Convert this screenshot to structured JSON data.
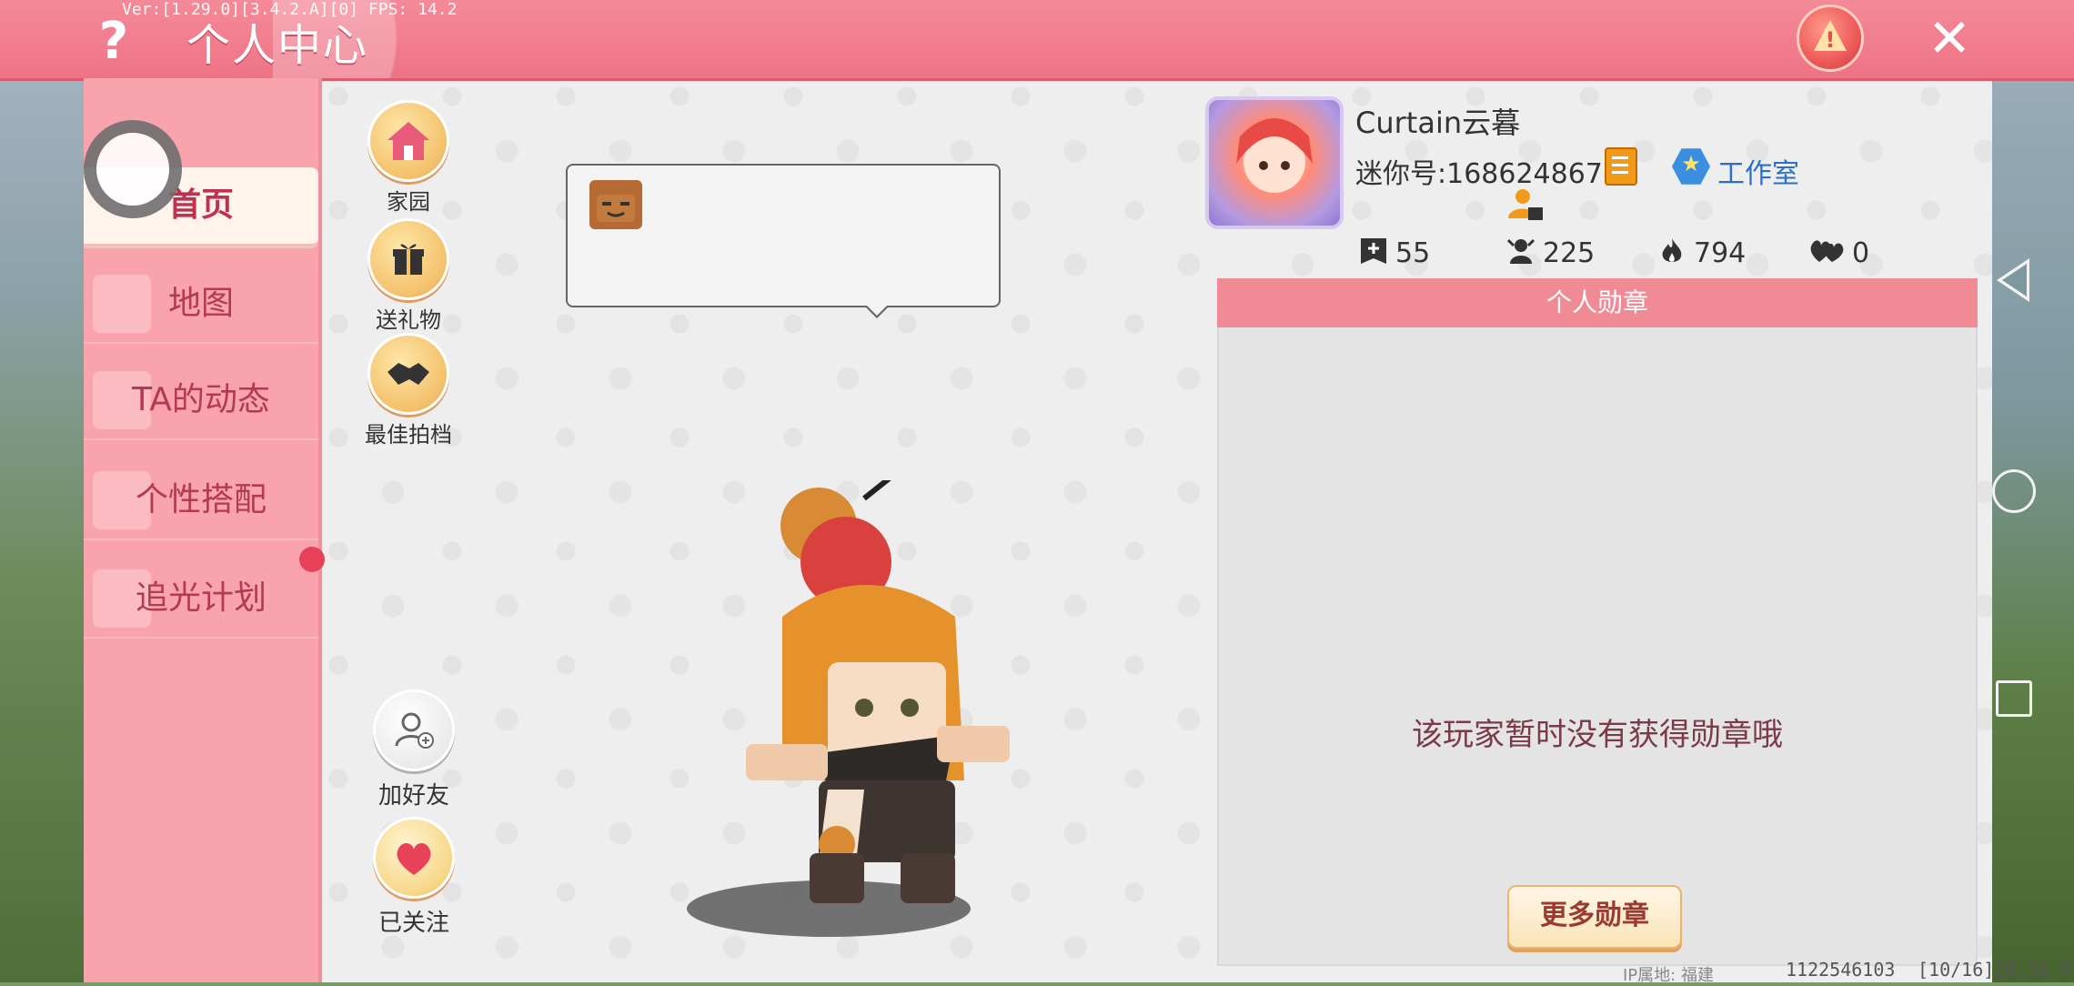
{
  "header": {
    "title": "个人中心",
    "version": "Ver:[1.29.0][3.4.2.A][0] FPS: 14.2",
    "help_icon": "question-icon",
    "warn_icon": "warning-icon",
    "close_icon": "close-icon",
    "bar_color": "#ee7385"
  },
  "sidebar": {
    "items": [
      {
        "label": "首页",
        "active": true
      },
      {
        "label": "地图",
        "active": false
      },
      {
        "label": "TA的动态",
        "active": false
      },
      {
        "label": "个性搭配",
        "active": false
      },
      {
        "label": "追光计划",
        "active": false
      }
    ],
    "color": "#f9a4ac"
  },
  "actions": {
    "home": "家园",
    "gift": "送礼物",
    "partner": "最佳拍档",
    "add_friend": "加好友",
    "followed": "已关注"
  },
  "profile": {
    "username": "Curtain云暮",
    "uid": "迷你号:1686248671",
    "studio": "工作室",
    "stats": [
      {
        "icon": "plus-square-icon",
        "value": "55"
      },
      {
        "icon": "fans-icon",
        "value": "225"
      },
      {
        "icon": "flame-icon",
        "value": "794"
      },
      {
        "icon": "hearts-icon",
        "value": "0"
      }
    ]
  },
  "medals": {
    "title": "个人勋章",
    "empty_text": "该玩家暂时没有获得勋章哦",
    "more_button": "更多勋章"
  },
  "footer": {
    "ip": "IP属地: 福建",
    "id": "1122546103",
    "time": "[10/16]20:58 0 1"
  }
}
